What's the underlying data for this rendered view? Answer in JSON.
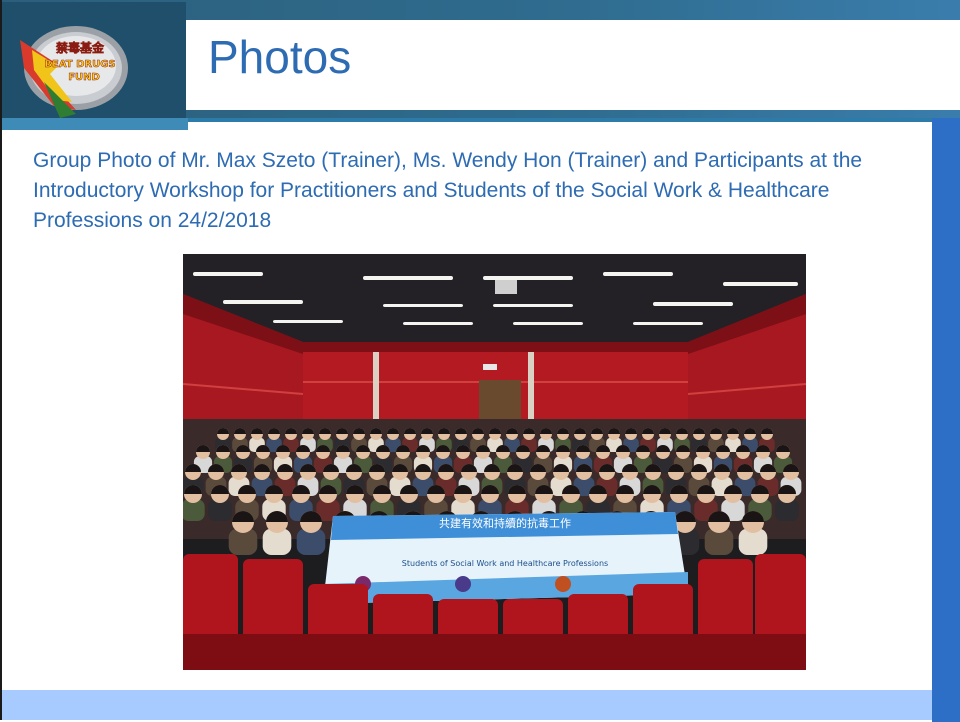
{
  "slide": {
    "title": "Photos",
    "caption": "Group Photo of Mr. Max Szeto (Trainer), Ms. Wendy Hon (Trainer) and Participants at the Introductory Workshop for Practitioners and Students of the Social Work & Healthcare Professions on 24/2/2018",
    "logo": {
      "name": "beat-drugs-fund-logo",
      "text_lines": [
        "禁毒基金",
        "BEAT DRUGS",
        "FUND"
      ]
    },
    "photo": {
      "name": "group-photo",
      "banner": {
        "chinese_line_1": "共建有效和持續的抗毒工作",
        "english_line": "Students of Social Work and Healthcare Professions"
      }
    }
  },
  "colors": {
    "title": "#2d6bb3",
    "header_band": "#2c5f7c",
    "right_bar": "#2d6fc6",
    "footer_band": "#a7cbff",
    "seat_red": "#b0141c",
    "wall_red": "#a81820"
  }
}
